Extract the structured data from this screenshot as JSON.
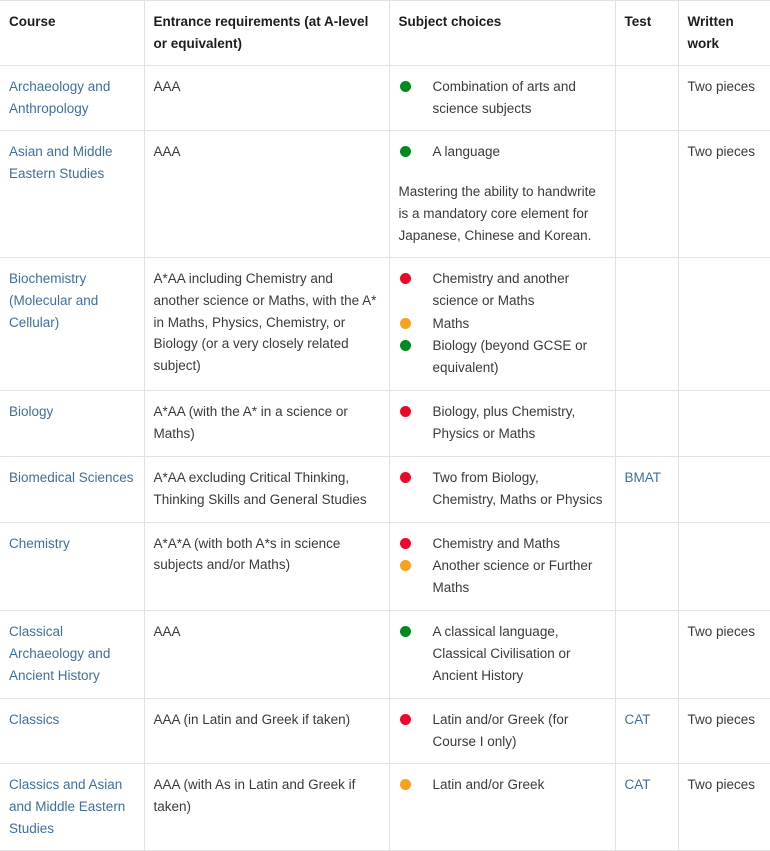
{
  "table": {
    "columns": [
      {
        "label": "Course",
        "key": "course"
      },
      {
        "label": "Entrance requirements (at A-level or equivalent)",
        "key": "entrance"
      },
      {
        "label": "Subject choices",
        "key": "subject"
      },
      {
        "label": "Test",
        "key": "test"
      },
      {
        "label": "Written work",
        "key": "written"
      }
    ],
    "colors": {
      "link": "#3f6f9e",
      "red": "#ec0928",
      "amber": "#f9a11b",
      "green": "#008a20",
      "border": "#e2e2e2",
      "text": "#3a3a3a",
      "header_text": "#1d1d1d"
    },
    "rows": [
      {
        "course": "Archaeology and Anthropology",
        "entrance": "AAA",
        "choices": [
          {
            "dot": "green",
            "text": "Combination of arts and science subjects"
          }
        ],
        "note": "",
        "test": "",
        "written": "Two pieces"
      },
      {
        "course": "Asian and Middle Eastern Studies",
        "entrance": "AAA",
        "choices": [
          {
            "dot": "green",
            "text": "A language"
          }
        ],
        "note": "Mastering the ability to handwrite is a mandatory core element for Japanese, Chinese and Korean.",
        "test": "",
        "written": "Two pieces"
      },
      {
        "course": "Biochemistry (Molecular and Cellular)",
        "entrance": "A*AA including Chemistry and another science or Maths, with the A* in Maths, Physics, Chemistry, or Biology (or a very closely related subject)",
        "choices": [
          {
            "dot": "red",
            "text": "Chemistry and another science or Maths"
          },
          {
            "dot": "amber",
            "text": "Maths"
          },
          {
            "dot": "green",
            "text": "Biology (beyond GCSE or equivalent)"
          }
        ],
        "note": "",
        "test": "",
        "written": ""
      },
      {
        "course": "Biology",
        "entrance": "A*AA (with the A* in a science or Maths)",
        "choices": [
          {
            "dot": "red",
            "text": "Biology, plus Chemistry, Physics or Maths"
          }
        ],
        "note": "",
        "test": "",
        "written": ""
      },
      {
        "course": "Biomedical Sciences",
        "entrance": "A*AA excluding Critical Thinking, Thinking Skills and General Studies",
        "choices": [
          {
            "dot": "red",
            "text": "Two from Biology, Chemistry, Maths or Physics"
          }
        ],
        "note": "",
        "test": "BMAT",
        "written": ""
      },
      {
        "course": "Chemistry",
        "entrance": "A*A*A (with both A*s in science subjects and/or Maths)",
        "choices": [
          {
            "dot": "red",
            "text": "Chemistry and Maths"
          },
          {
            "dot": "amber",
            "text": "Another science or Further Maths"
          }
        ],
        "note": "",
        "test": "",
        "written": ""
      },
      {
        "course": "Classical Archaeology and Ancient History",
        "entrance": "AAA",
        "choices": [
          {
            "dot": "green",
            "text": "A classical language, Classical Civilisation or Ancient History"
          }
        ],
        "note": "",
        "test": "",
        "written": "Two pieces"
      },
      {
        "course": "Classics",
        "entrance": "AAA (in Latin and Greek if taken)",
        "choices": [
          {
            "dot": "red",
            "text": "Latin and/or Greek (for Course I only)"
          }
        ],
        "note": "",
        "test": "CAT",
        "written": "Two pieces"
      },
      {
        "course": "Classics and Asian and Middle Eastern Studies",
        "entrance": "AAA (with As in Latin and Greek if taken)",
        "choices": [
          {
            "dot": "amber",
            "text": "Latin and/or Greek"
          }
        ],
        "note": "",
        "test": "CAT",
        "written": "Two pieces"
      }
    ]
  }
}
